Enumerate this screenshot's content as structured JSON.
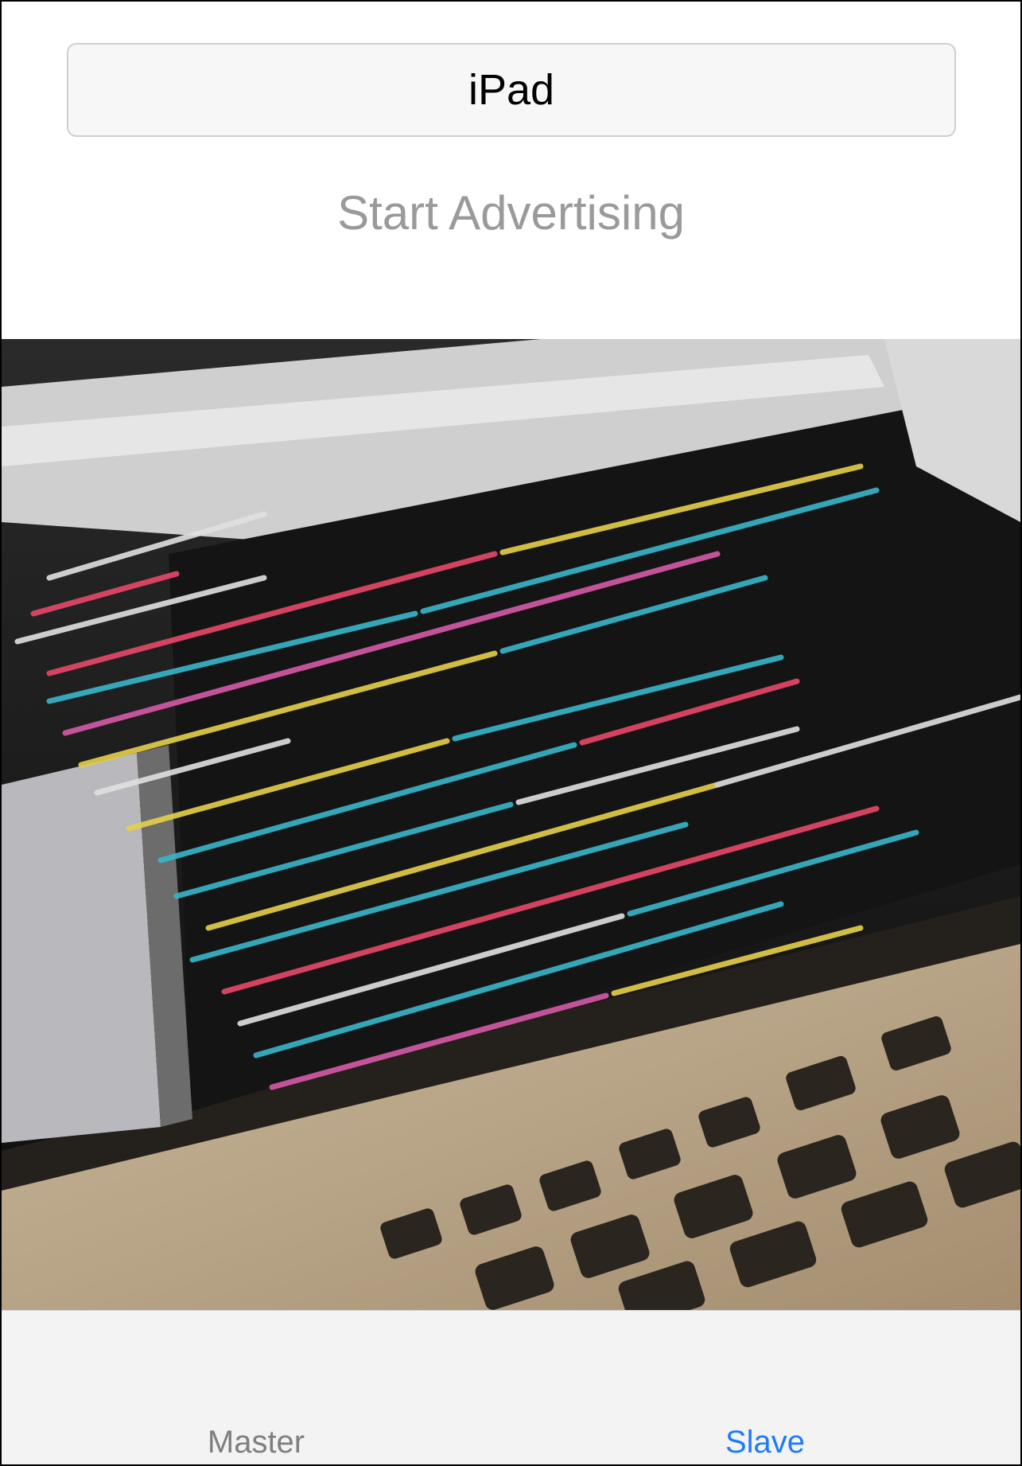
{
  "device_name_field": {
    "value": "iPad"
  },
  "advertise_button": {
    "label": "Start Advertising"
  },
  "tab_bar": {
    "tabs": [
      {
        "label": "Master",
        "selected": false
      },
      {
        "label": "Slave",
        "selected": true
      }
    ],
    "selected_color": "#1f7cf6",
    "unselected_color": "#7f7f7f"
  },
  "photo": {
    "subject": "laptop-screen-code-photo"
  }
}
